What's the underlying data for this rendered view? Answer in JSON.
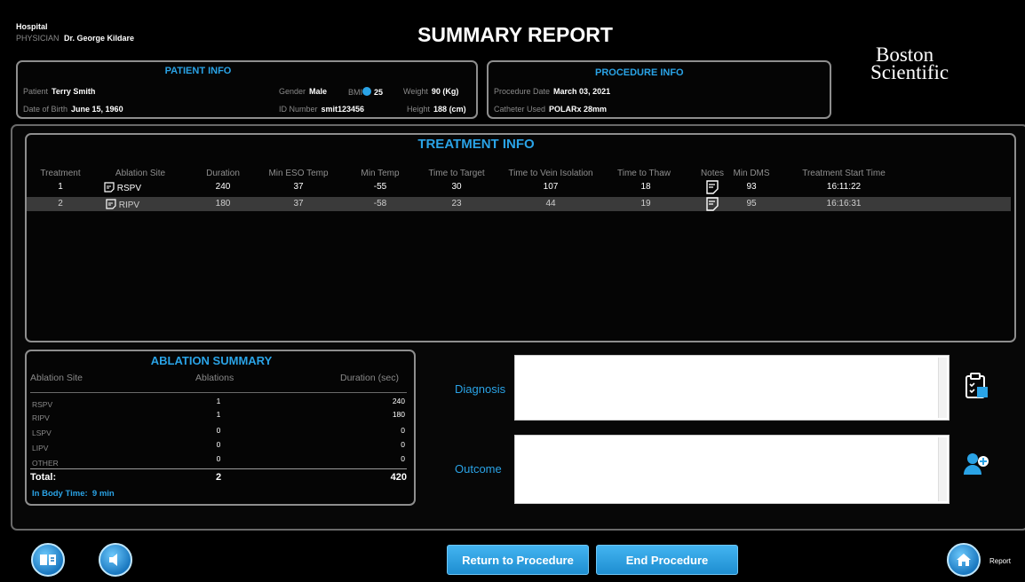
{
  "header": {
    "hospital_label": "Hospital",
    "physician_label": "PHYSICIAN",
    "physician_name": "Dr. George Kildare",
    "title": "SUMMARY REPORT",
    "logo_line1": "Boston",
    "logo_line2": "Scientific"
  },
  "patient_info": {
    "title": "PATIENT INFO",
    "patient_label": "Patient",
    "patient_value": "Terry Smith",
    "dob_label": "Date of Birth",
    "dob_value": "June 15, 1960",
    "gender_label": "Gender",
    "gender_value": "Male",
    "bmi_label": "BMI",
    "bmi_value": "25",
    "weight_label": "Weight",
    "weight_value": "90",
    "weight_unit": "(Kg)",
    "id_label": "ID Number",
    "id_value": "smit123456",
    "height_label": "Height",
    "height_value": "188",
    "height_unit": "(cm)"
  },
  "procedure_info": {
    "title": "PROCEDURE INFO",
    "date_label": "Procedure Date",
    "date_value": "March 03, 2021",
    "catheter_label": "Catheter Used",
    "catheter_value": "POLARx 28mm"
  },
  "treatment_info": {
    "title": "TREATMENT INFO",
    "columns": [
      "Treatment",
      "Ablation Site",
      "Duration",
      "Min ESO Temp",
      "Min Temp",
      "Time to Target",
      "Time to Vein Isolation",
      "Time to Thaw",
      "Notes",
      "Min DMS",
      "Treatment Start Time"
    ],
    "rows": [
      {
        "treatment": "1",
        "site": "RSPV",
        "duration": "240",
        "min_eso": "37",
        "min_temp": "-55",
        "time_target": "30",
        "time_vein": "107",
        "time_thaw": "18",
        "min_dms": "93",
        "start": "16:11:22"
      },
      {
        "treatment": "2",
        "site": "RIPV",
        "duration": "180",
        "min_eso": "37",
        "min_temp": "-58",
        "time_target": "23",
        "time_vein": "44",
        "time_thaw": "19",
        "min_dms": "95",
        "start": "16:16:31"
      }
    ]
  },
  "ablation_summary": {
    "title": "ABLATION SUMMARY",
    "col_site": "Ablation Site",
    "col_ablations": "Ablations",
    "col_duration": "Duration (sec)",
    "rows": [
      {
        "site": "RSPV",
        "ablations": "1",
        "duration": "240"
      },
      {
        "site": "RIPV",
        "ablations": "1",
        "duration": "180"
      },
      {
        "site": "LSPV",
        "ablations": "0",
        "duration": "0"
      },
      {
        "site": "LIPV",
        "ablations": "0",
        "duration": "0"
      },
      {
        "site": "OTHER",
        "ablations": "0",
        "duration": "0"
      }
    ],
    "total_label": "Total:",
    "total_ablations": "2",
    "total_duration": "420",
    "in_body_label": "In Body Time:",
    "in_body_value": "9 min"
  },
  "diagnosis": {
    "label": "Diagnosis",
    "value": ""
  },
  "outcome": {
    "label": "Outcome",
    "value": ""
  },
  "footer": {
    "return_label": "Return to Procedure",
    "end_label": "End Procedure",
    "report_label": "Report"
  },
  "colors": {
    "accent": "#2aa3e6",
    "panel_border": "#8e8e8e",
    "selected_row": "#3a3a3a"
  }
}
